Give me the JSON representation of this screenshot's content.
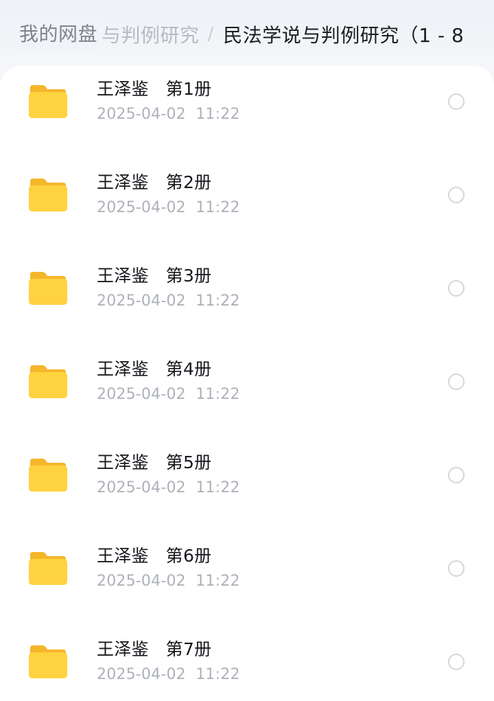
{
  "breadcrumb": {
    "home": "我的网盘",
    "previous": "与判例研究",
    "separator": "/",
    "current": "民法学说与判例研究（1 - 8"
  },
  "colors": {
    "folder": "#ffd23f",
    "folder_tab": "#f7b928",
    "title_text": "#16181d",
    "meta_text": "#adb1b9"
  },
  "files": [
    {
      "name": "王泽鉴   第1册",
      "date": "2025-04-02  11:22",
      "icon": "folder-icon",
      "selected": false
    },
    {
      "name": "王泽鉴   第2册",
      "date": "2025-04-02  11:22",
      "icon": "folder-icon",
      "selected": false
    },
    {
      "name": "王泽鉴   第3册",
      "date": "2025-04-02  11:22",
      "icon": "folder-icon",
      "selected": false
    },
    {
      "name": "王泽鉴   第4册",
      "date": "2025-04-02  11:22",
      "icon": "folder-icon",
      "selected": false
    },
    {
      "name": "王泽鉴   第5册",
      "date": "2025-04-02  11:22",
      "icon": "folder-icon",
      "selected": false
    },
    {
      "name": "王泽鉴   第6册",
      "date": "2025-04-02  11:22",
      "icon": "folder-icon",
      "selected": false
    },
    {
      "name": "王泽鉴   第7册",
      "date": "2025-04-02  11:22",
      "icon": "folder-icon",
      "selected": false
    }
  ]
}
